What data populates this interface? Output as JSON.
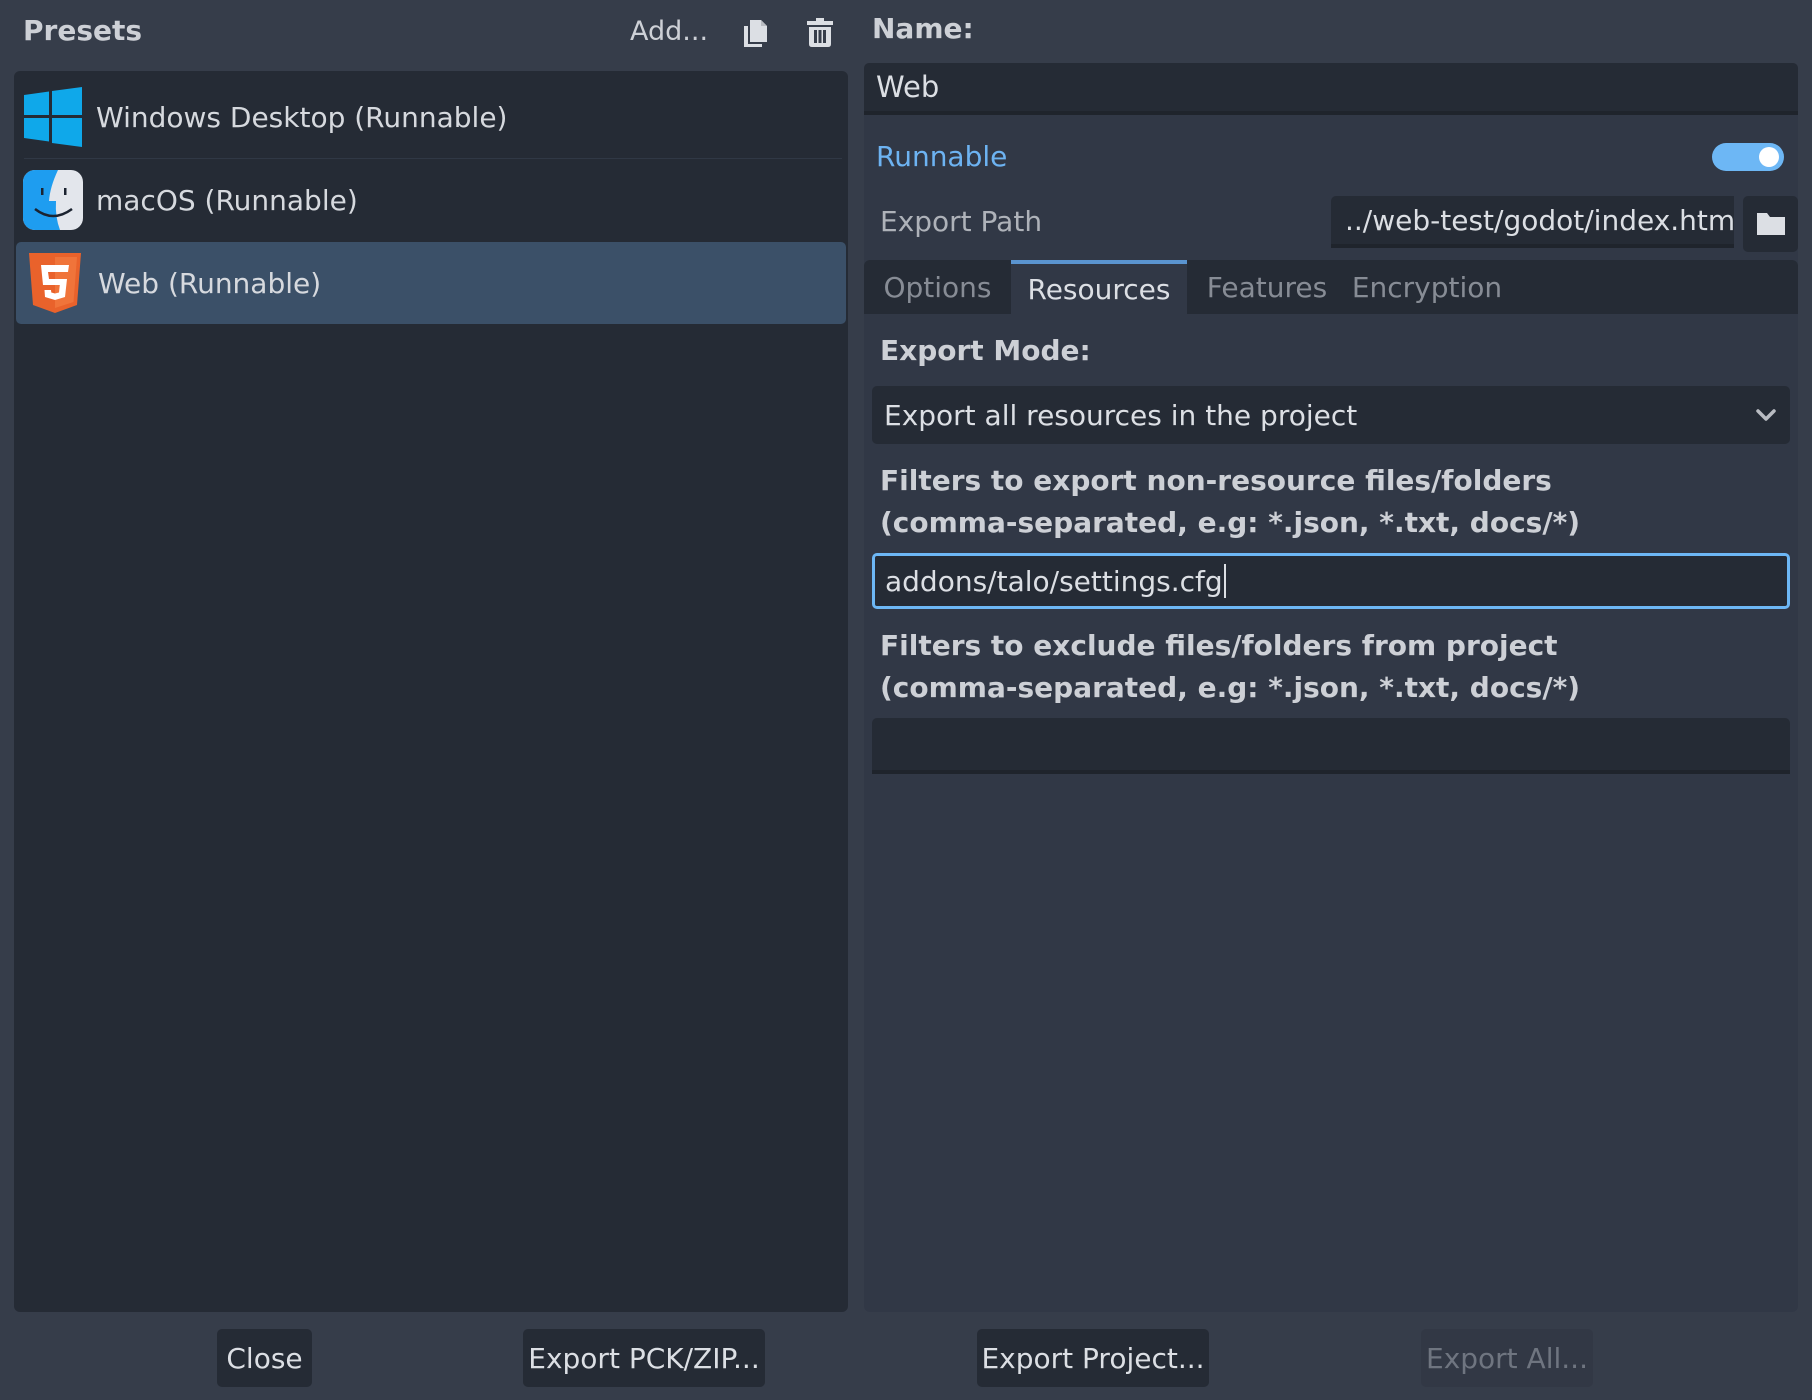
{
  "presets_panel": {
    "title": "Presets",
    "add_label": "Add...",
    "duplicate_icon": "duplicate-icon",
    "delete_icon": "trash-icon",
    "items": [
      {
        "label": "Windows Desktop (Runnable)",
        "icon": "windows-logo-icon",
        "selected": false
      },
      {
        "label": "macOS (Runnable)",
        "icon": "macos-finder-icon",
        "selected": false
      },
      {
        "label": "Web (Runnable)",
        "icon": "html5-icon",
        "selected": true
      }
    ]
  },
  "details": {
    "name_label": "Name:",
    "name_value": "Web",
    "runnable_label": "Runnable",
    "runnable_on": true,
    "export_path_label": "Export Path",
    "export_path_value": "../web-test/godot/index.html",
    "tabs": [
      {
        "label": "Options",
        "active": false
      },
      {
        "label": "Resources",
        "active": true
      },
      {
        "label": "Features",
        "active": false
      },
      {
        "label": "Encryption",
        "active": false
      }
    ],
    "export_mode_label": "Export Mode:",
    "export_mode_value": "Export all resources in the project",
    "filters_label_line1": "Filters to export non-resource files/folders",
    "filters_label_line2": "(comma-separated, e.g: *.json, *.txt, docs/*)",
    "filters_value": "addons/talo/settings.cfg",
    "exclude_label_line1": "Filters to exclude files/folders from project",
    "exclude_label_line2": "(comma-separated, e.g: *.json, *.txt, docs/*)",
    "exclude_value": ""
  },
  "footer": {
    "close_label": "Close",
    "export_pck_label": "Export PCK/ZIP...",
    "export_project_label": "Export Project...",
    "export_all_label": "Export All...",
    "export_all_disabled": true
  },
  "colors": {
    "accent": "#6db7f5",
    "selected_row": "#3b5068",
    "tab_active_indicator": "#5a94d0"
  }
}
